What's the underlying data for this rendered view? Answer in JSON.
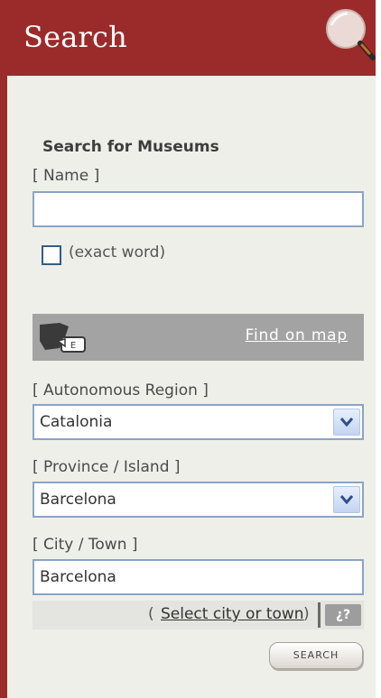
{
  "header": {
    "title": "Search",
    "icon": "magnifier-icon",
    "color": "#9b2b2b"
  },
  "form": {
    "section_title": "Search for Museums",
    "name_label": "[ Name ]",
    "name_value": "",
    "exact_word_label": "(exact word)",
    "exact_word_checked": false,
    "map_link": "Find on map",
    "region_label": "[ Autonomous Region ]",
    "region_value": "Catalonia",
    "province_label": "[ Province / Island ]",
    "province_value": "Barcelona",
    "city_label": "[ City / Town ]",
    "city_value": "Barcelona",
    "city_paren_open": "(",
    "select_city_link": "Select city or town",
    "city_paren_close": ")",
    "help_text": "¿?",
    "search_button": "SEARCH"
  }
}
